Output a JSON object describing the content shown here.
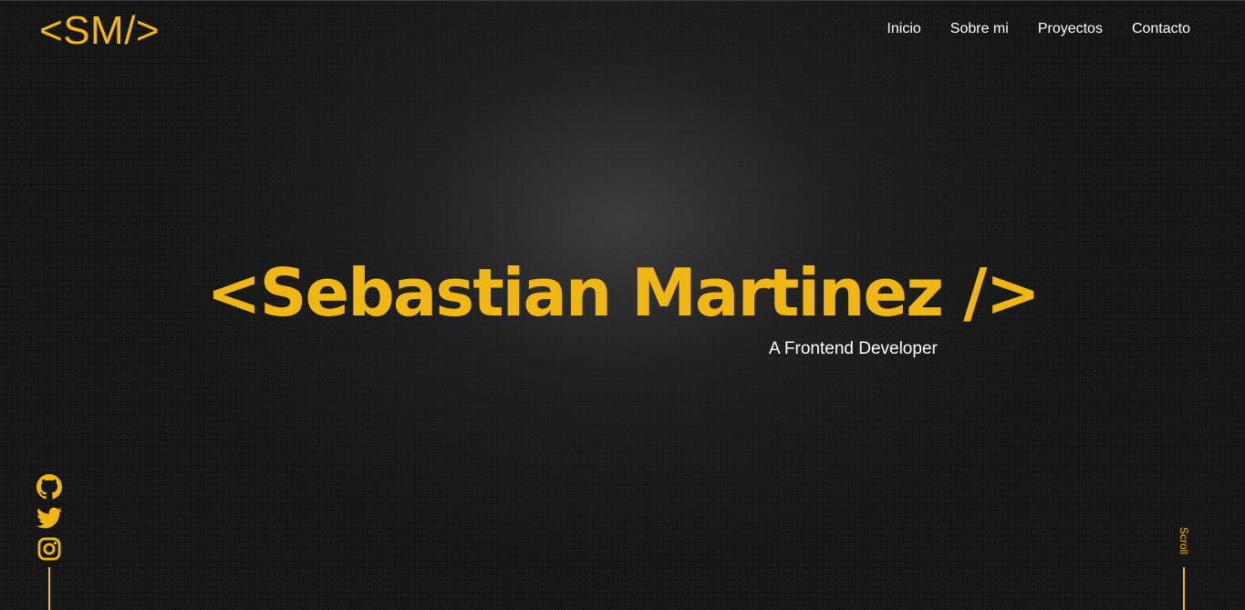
{
  "header": {
    "logo": "<SM/>",
    "nav": [
      {
        "label": "Inicio"
      },
      {
        "label": "Sobre mi"
      },
      {
        "label": "Proyectos"
      },
      {
        "label": "Contacto"
      }
    ]
  },
  "hero": {
    "title": "<Sebastian Martinez />",
    "subtitle": "A Frontend Developer"
  },
  "social": {
    "icons": [
      "github-icon",
      "twitter-icon",
      "instagram-icon"
    ]
  },
  "scroll": {
    "label": "Scroll"
  },
  "colors": {
    "accent": "#f0b614",
    "background": "#141414",
    "text": "#ffffff"
  }
}
